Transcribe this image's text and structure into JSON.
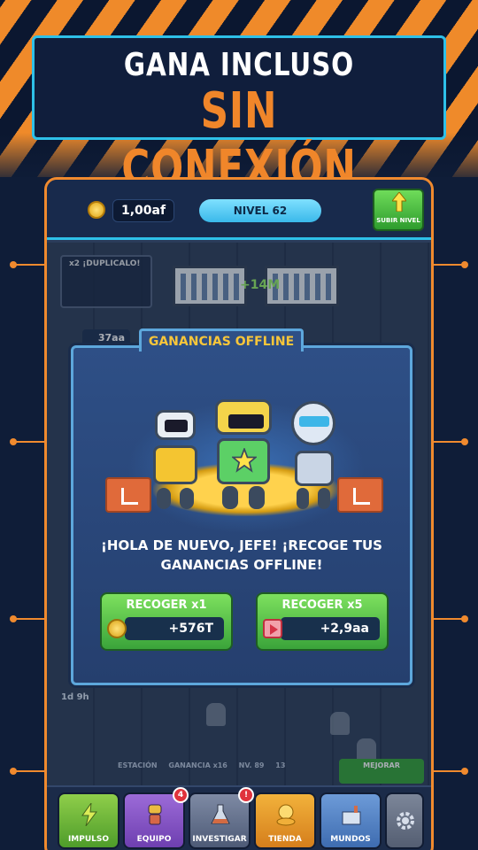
{
  "headline": {
    "line1": "GANA INCLUSO",
    "line2": "SIN CONEXIÓN"
  },
  "topbar": {
    "cash": "1,00af",
    "level": "NIVEL 62",
    "levelup_label": "SUBIR NIVEL"
  },
  "scene": {
    "duplicate_label": "x2 ¡DUPLICALO!",
    "floating_gain": "+14M",
    "cash_tag": "37aa",
    "shaft_time": "1d 9h",
    "status": {
      "station": "ESTACIÓN",
      "gain": "GANANCIA x16",
      "level": "NV. 89",
      "stars": "13",
      "upgrade": "MEJORAR"
    }
  },
  "modal": {
    "title": "GANANCIAS OFFLINE",
    "message": "¡HOLA DE NUEVO, JEFE! ¡RECOGE TUS GANANCIAS OFFLINE!",
    "collect_x1": {
      "label": "RECOGER x1",
      "value": "+576T"
    },
    "collect_x5": {
      "label": "RECOGER x5",
      "value": "+2,9aa"
    }
  },
  "nav": {
    "impulso": "IMPULSO",
    "equipo": "EQUIPO",
    "equipo_badge": "4",
    "investigar": "INVESTIGAR",
    "investigar_badge": "!",
    "tienda": "TIENDA",
    "mundos": "MUNDOS"
  },
  "colors": {
    "accent_orange": "#f08a2e",
    "accent_cyan": "#2ec0e8",
    "title_gold": "#f8c63a",
    "button_green": "#3aa43a"
  }
}
